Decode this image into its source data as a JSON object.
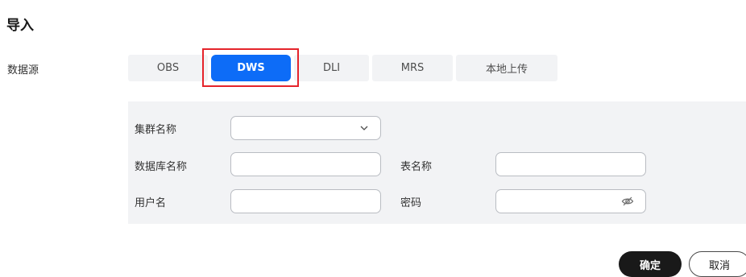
{
  "page": {
    "title": "导入"
  },
  "source": {
    "label": "数据源",
    "tabs": [
      {
        "label": "OBS",
        "active": false
      },
      {
        "label": "DWS",
        "active": true
      },
      {
        "label": "DLI",
        "active": false
      },
      {
        "label": "MRS",
        "active": false
      },
      {
        "label": "本地上传",
        "active": false
      }
    ]
  },
  "form": {
    "cluster_label": "集群名称",
    "cluster_value": "",
    "database_label": "数据库名称",
    "database_value": "",
    "table_label": "表名称",
    "table_value": "",
    "username_label": "用户名",
    "username_value": "",
    "password_label": "密码",
    "password_value": ""
  },
  "actions": {
    "confirm_label": "确定",
    "cancel_label": "取消"
  },
  "colors": {
    "accent": "#0d6cf7",
    "highlight": "#e5242b",
    "panel_bg": "#f2f3f5",
    "confirm_bg": "#191919"
  },
  "icons": {
    "select": "chevron-down-icon",
    "password": "eye-off-icon"
  }
}
